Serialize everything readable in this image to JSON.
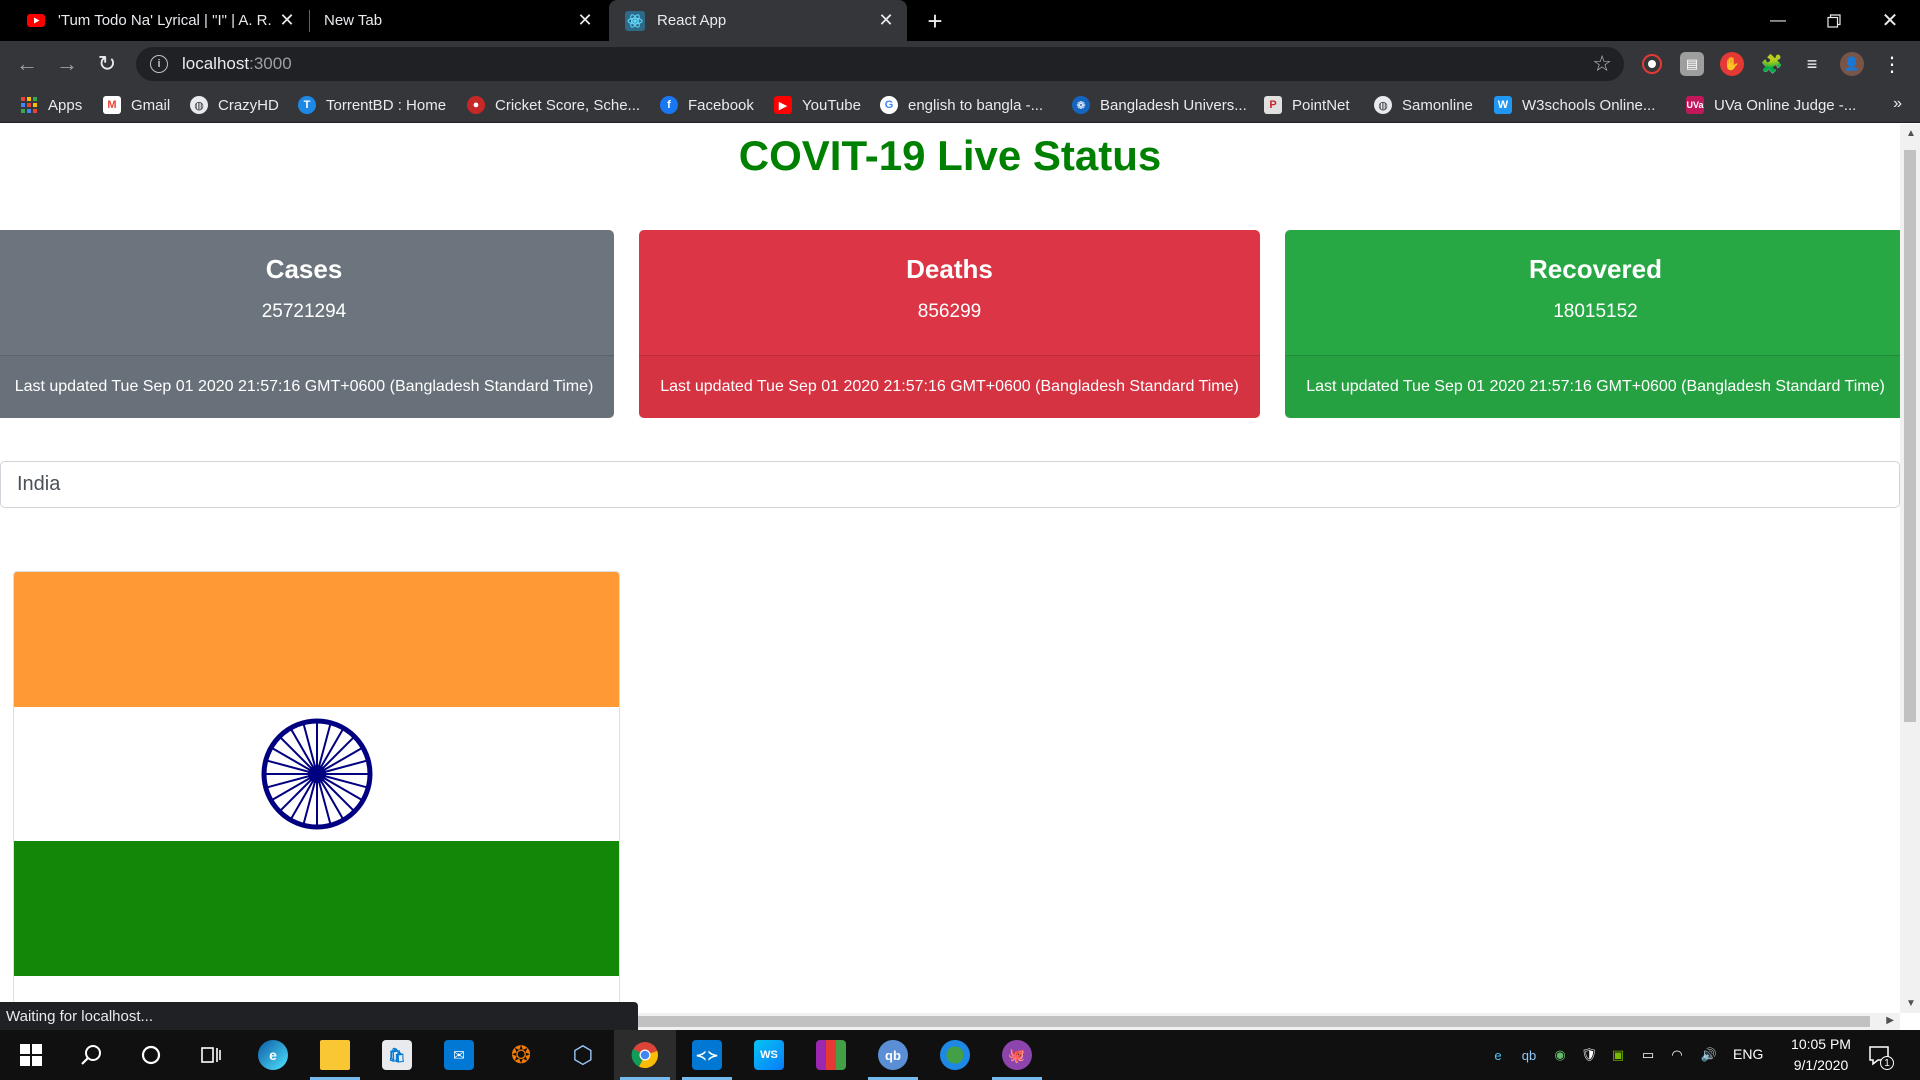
{
  "browser": {
    "tabs": [
      {
        "title": "'Tum Todo Na' Lyrical | \"I\" | A. R. R",
        "favicon": "youtube-icon",
        "active": false
      },
      {
        "title": "New Tab",
        "favicon": "none",
        "active": false
      },
      {
        "title": "React App",
        "favicon": "react-icon",
        "active": true
      }
    ],
    "address": {
      "host": "localhost",
      "port": ":3000"
    },
    "bookmarks": [
      {
        "label": "Apps",
        "icon": "apps-grid-icon",
        "color": "#ea4335"
      },
      {
        "label": "Gmail",
        "icon": "gmail-icon",
        "color": "#ea4335"
      },
      {
        "label": "CrazyHD",
        "icon": "globe-icon",
        "color": "#5f6368"
      },
      {
        "label": "TorrentBD : Home",
        "icon": "torrentbd-icon",
        "color": "#1e88e5"
      },
      {
        "label": "Cricket Score, Sche...",
        "icon": "cricket-icon",
        "color": "#c62828"
      },
      {
        "label": "Facebook",
        "icon": "facebook-icon",
        "color": "#1877f2"
      },
      {
        "label": "YouTube",
        "icon": "youtube-icon",
        "color": "#ff0000"
      },
      {
        "label": "english to bangla -...",
        "icon": "google-icon",
        "color": "#ffffff"
      },
      {
        "label": "Bangladesh Univers...",
        "icon": "university-icon",
        "color": "#1565c0"
      },
      {
        "label": "PointNet",
        "icon": "pointnet-icon",
        "color": "#e0e0e0"
      },
      {
        "label": "Samonline",
        "icon": "globe-icon",
        "color": "#5f6368"
      },
      {
        "label": "W3schools Online...",
        "icon": "w3schools-icon",
        "color": "#2196f3"
      },
      {
        "label": "UVa Online Judge -...",
        "icon": "uva-icon",
        "color": "#c2185b"
      }
    ]
  },
  "page": {
    "title": "COVIT-19 Live Status",
    "cards": [
      {
        "title": "Cases",
        "value": "25721294",
        "footer": "Last updated Tue Sep 01 2020 21:57:16 GMT+0600 (Bangladesh Standard Time)",
        "color": "#6c757d"
      },
      {
        "title": "Deaths",
        "value": "856299",
        "footer": "Last updated Tue Sep 01 2020 21:57:16 GMT+0600 (Bangladesh Standard Time)",
        "color": "#dc3545"
      },
      {
        "title": "Recovered",
        "value": "18015152",
        "footer": "Last updated Tue Sep 01 2020 21:57:16 GMT+0600 (Bangladesh Standard Time)",
        "color": "#28a745"
      }
    ],
    "search_value": "India",
    "flag": {
      "country": "India",
      "colors": {
        "saffron": "#ff9933",
        "white": "#ffffff",
        "green": "#138808",
        "chakra": "#000080"
      }
    },
    "status_text": "Waiting for localhost..."
  },
  "taskbar": {
    "apps": [
      "start-icon",
      "search-icon",
      "cortana-icon",
      "task-view-icon",
      "edge-icon",
      "file-explorer-icon",
      "store-icon",
      "mail-icon",
      "app-icon",
      "virtualbox-icon",
      "chrome-icon",
      "vscode-icon",
      "webstorm-icon",
      "winrar-icon",
      "qbittorrent-icon",
      "network-icon",
      "github-desktop-icon"
    ],
    "language": "ENG",
    "time": "10:05 PM",
    "date": "9/1/2020",
    "notification_count": "1"
  }
}
